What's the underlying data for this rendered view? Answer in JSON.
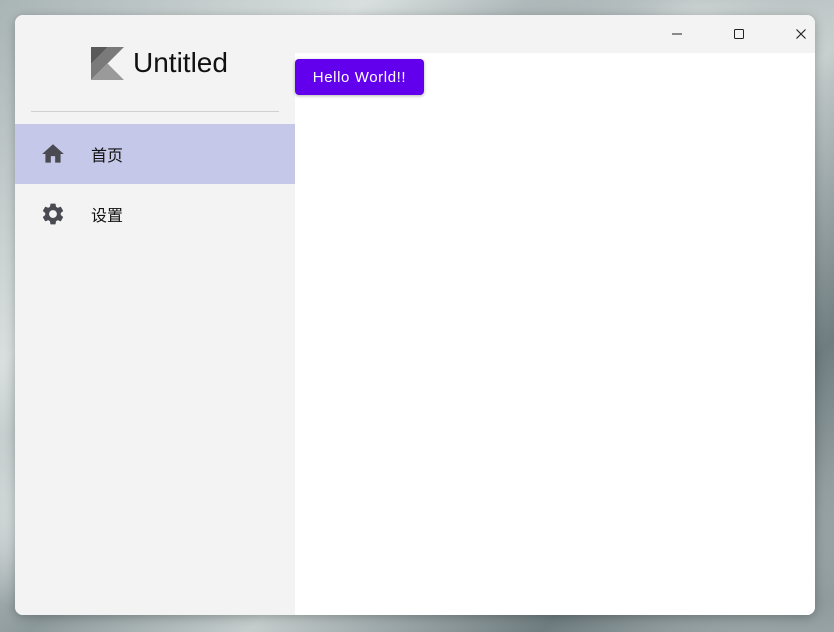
{
  "app": {
    "title": "Untitled",
    "logo_icon": "kotlin-logo-icon"
  },
  "window_controls": {
    "minimize_icon": "minimize-icon",
    "maximize_icon": "maximize-icon",
    "close_icon": "close-icon"
  },
  "sidebar": {
    "items": [
      {
        "label": "首页",
        "icon": "home-icon",
        "selected": true
      },
      {
        "label": "设置",
        "icon": "gear-icon",
        "selected": false
      }
    ]
  },
  "main": {
    "button_label": "Hello World!!"
  },
  "colors": {
    "accent": "#6200ee",
    "selected_nav": "#c5c8e8",
    "sidebar_bg": "#f3f3f3",
    "content_bg": "#ffffff",
    "icon": "#4a4a52"
  }
}
